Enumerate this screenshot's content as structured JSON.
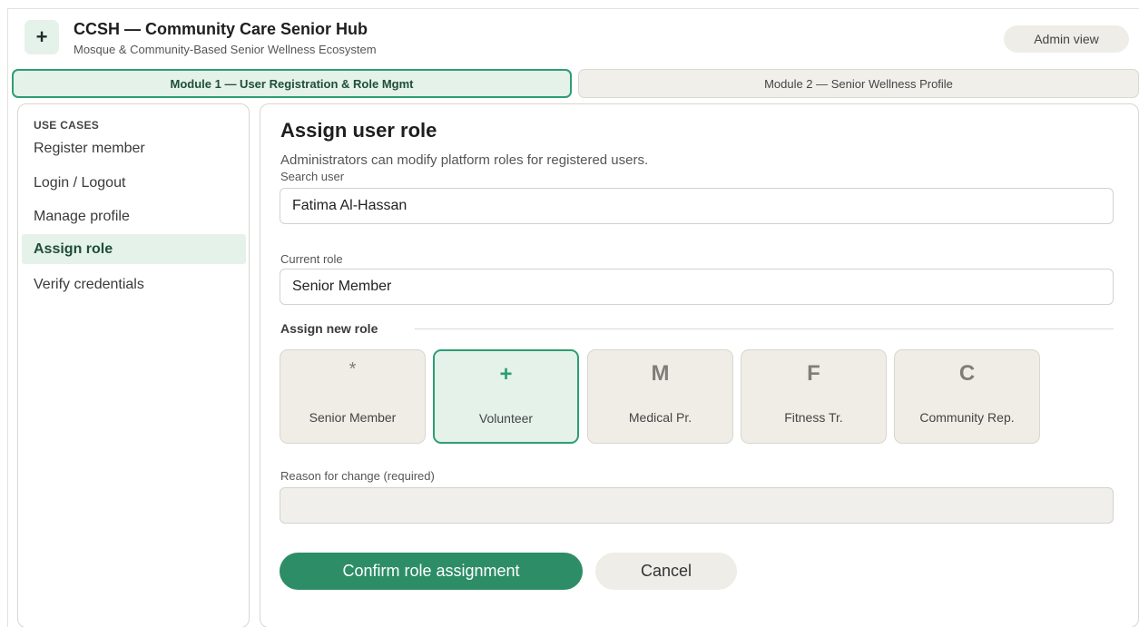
{
  "app": {
    "logo_glyph": "+",
    "title": "CCSH — Community Care Senior Hub",
    "subtitle": "Mosque & Community-Based Senior Wellness Ecosystem",
    "admin_label": "Admin view"
  },
  "modules": [
    {
      "label": "Module 1 — User Registration & Role Mgmt",
      "active": true
    },
    {
      "label": "Module 2 — Senior Wellness Profile",
      "active": false
    }
  ],
  "sidebar": {
    "heading": "USE CASES",
    "items": [
      {
        "label": "Register member",
        "active": false
      },
      {
        "label": "Login / Logout",
        "active": false
      },
      {
        "label": "Manage profile",
        "active": false
      },
      {
        "label": "Assign role",
        "active": true
      },
      {
        "label": "Verify credentials",
        "active": false
      }
    ]
  },
  "main": {
    "title": "Assign user role",
    "description": "Administrators can modify platform roles for registered users.",
    "search_label": "Search user",
    "search_value": "Fatima Al-Hassan",
    "current_role_label": "Current role",
    "current_role_value": "Senior Member",
    "assign_label": "Assign new role",
    "roles": [
      {
        "glyph": "*",
        "label": "Senior Member",
        "selected": false
      },
      {
        "glyph": "+",
        "label": "Volunteer",
        "selected": true
      },
      {
        "glyph": "M",
        "label": "Medical Pr.",
        "selected": false
      },
      {
        "glyph": "F",
        "label": "Fitness Tr.",
        "selected": false
      },
      {
        "glyph": "C",
        "label": "Community Rep.",
        "selected": false
      }
    ],
    "reason_label": "Reason for change (required)",
    "reason_value": "",
    "confirm_label": "Confirm role assignment",
    "cancel_label": "Cancel"
  },
  "colors": {
    "accent": "#2e9e73",
    "accent_light": "#e4f2ea",
    "confirm_bg": "#2c8d66",
    "neutral_bg": "#f0ede6"
  }
}
